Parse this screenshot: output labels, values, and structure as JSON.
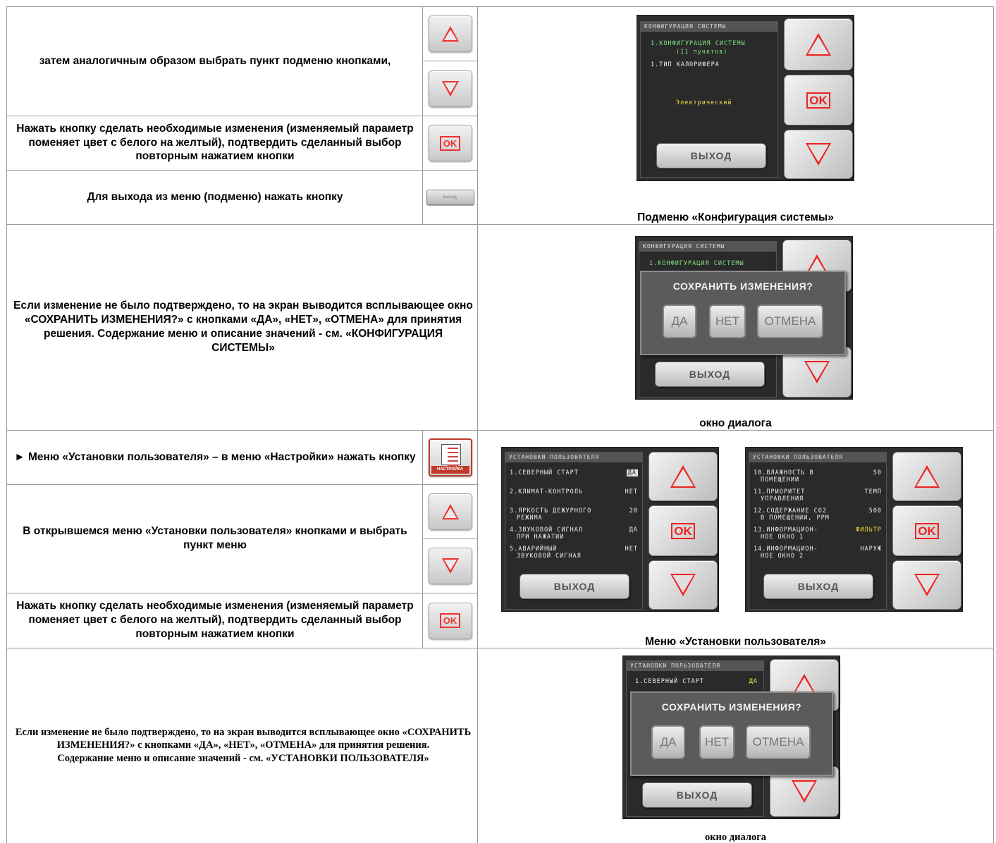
{
  "rows": {
    "r1_text": "затем аналогичным образом выбрать пункт подменю кнопками,",
    "r2_text": "Нажать кнопку сделать необходимые изменения (изменяемый параметр поменяет цвет с белого на желтый), подтвердить сделанный выбор повторным нажатием кнопки",
    "r3_text": "Для выхода из меню (подменю) нажать кнопку",
    "r4_text": "Если изменение не было подтверждено, то на экран выводится всплывающее окно «СОХРАНИТЬ ИЗМЕНЕНИЯ?» с кнопками «ДА», «НЕТ», «ОТМЕНА» для принятия решения. Содержание меню и описание значений - см. «КОНФИГУРАЦИЯ СИСТЕМЫ»",
    "r5_text": "► Меню «Установки пользователя» – в меню «Настройки» нажать кнопку",
    "r6_text": "В открывшемся меню «Установки пользователя» кнопками и выбрать пункт меню",
    "r7_text": "Нажать кнопку сделать необходимые изменения (изменяемый параметр поменяет цвет с белого на желтый), подтвердить сделанный выбор повторным нажатием кнопки",
    "r8_line1": "Если изменение не было подтверждено, то на экран выводится всплывающее окно «СОХРАНИТЬ ИЗМЕНЕНИЯ?» с кнопками «ДА», «НЕТ», «ОТМЕНА» для принятия решения.",
    "r8_line2": "Содержание меню и описание значений - см. «УСТАНОВКИ ПОЛЬЗОВАТЕЛЯ»"
  },
  "icons": {
    "ok": "OK",
    "exit_mini": "выход",
    "settings": "НАСТРОЙКА"
  },
  "captions": {
    "c1": "Подменю «Конфигурация системы»",
    "c2": "окно диалога",
    "c3": "Меню «Установки пользователя»",
    "c4": "окно диалога"
  },
  "screen1": {
    "title": "КОНФИГУРАЦИЯ СИСТЕМЫ",
    "item1": "1.КОНФИГУРАЦИЯ СИСТЕМЫ",
    "item1_sub": "(11 пунктов)",
    "item2": "1.ТИП КАЛОРИФЕРА",
    "value": "Электрический",
    "exit": "ВЫХОД",
    "ok": "OK"
  },
  "screen2": {
    "title": "КОНФИГУРАЦИЯ СИСТЕМЫ",
    "item1": "1.КОНФИГУРАЦИЯ СИСТЕМЫ",
    "dialog_title": "СОХРАНИТЬ ИЗМЕНЕНИЯ?",
    "yes": "ДА",
    "no": "НЕТ",
    "cancel": "ОТМЕНА",
    "exit": "ВЫХОД"
  },
  "screen3": {
    "title": "УСТАНОВКИ ПОЛЬЗОВАТЕЛЯ",
    "items": [
      {
        "l1": "1.СЕВЕРНЫЙ СТАРТ",
        "l2": "",
        "val": "ДА"
      },
      {
        "l1": "2.КЛИМАТ-КОНТРОЛЬ",
        "l2": "",
        "val": "НЕТ"
      },
      {
        "l1": "3.ЯРКОСТЬ ДЕЖУРНОГО",
        "l2": "РЕЖИМА",
        "val": "20"
      },
      {
        "l1": "4.ЗВУКОВОЙ СИГНАЛ",
        "l2": "ПРИ НАЖАТИИ",
        "val": "ДА"
      },
      {
        "l1": "5.АВАРИЙНЫЙ",
        "l2": "ЗВУКОВОЙ СИГНАЛ",
        "val": "НЕТ"
      }
    ],
    "exit": "ВЫХОД",
    "ok": "OK"
  },
  "screen4": {
    "title": "УСТАНОВКИ ПОЛЬЗОВАТЕЛЯ",
    "items": [
      {
        "l1": "10.ВЛАЖНОСТЬ В",
        "l2": "ПОМЕЩЕНИИ",
        "val": "50"
      },
      {
        "l1": "11.ПРИОРИТЕТ",
        "l2": "УПРАВЛЕНИЯ",
        "val": "ТЕМП"
      },
      {
        "l1": "12.СОДЕРЖАНИЕ СО2",
        "l2": "В ПОМЕЩЕНИИ, PPM",
        "val": "500"
      },
      {
        "l1": "13.ИНФОРМАЦИОН-",
        "l2": "НОЕ ОКНО 1",
        "val": "ФИЛЬТР"
      },
      {
        "l1": "14.ИНФОРМАЦИОН-",
        "l2": "НОЕ ОКНО 2",
        "val": "НАРУЖ"
      }
    ],
    "exit": "ВЫХОД",
    "ok": "OK"
  },
  "screen5": {
    "title": "УСТАНОВКИ ПОЛЬЗОВАТЕЛЯ",
    "item1": "1.СЕВЕРНЫЙ СТАРТ",
    "item1_val": "ДА",
    "dialog_title": "СОХРАНИТЬ ИЗМЕНЕНИЯ?",
    "yes": "ДА",
    "no": "НЕТ",
    "cancel": "ОТМЕНА",
    "exit": "ВЫХОД"
  },
  "colors": {
    "accent_red": "#ee2222",
    "menu_green": "#7fe07f",
    "value_yellow": "#f0e040",
    "grid_line": "#9a9a9a"
  }
}
